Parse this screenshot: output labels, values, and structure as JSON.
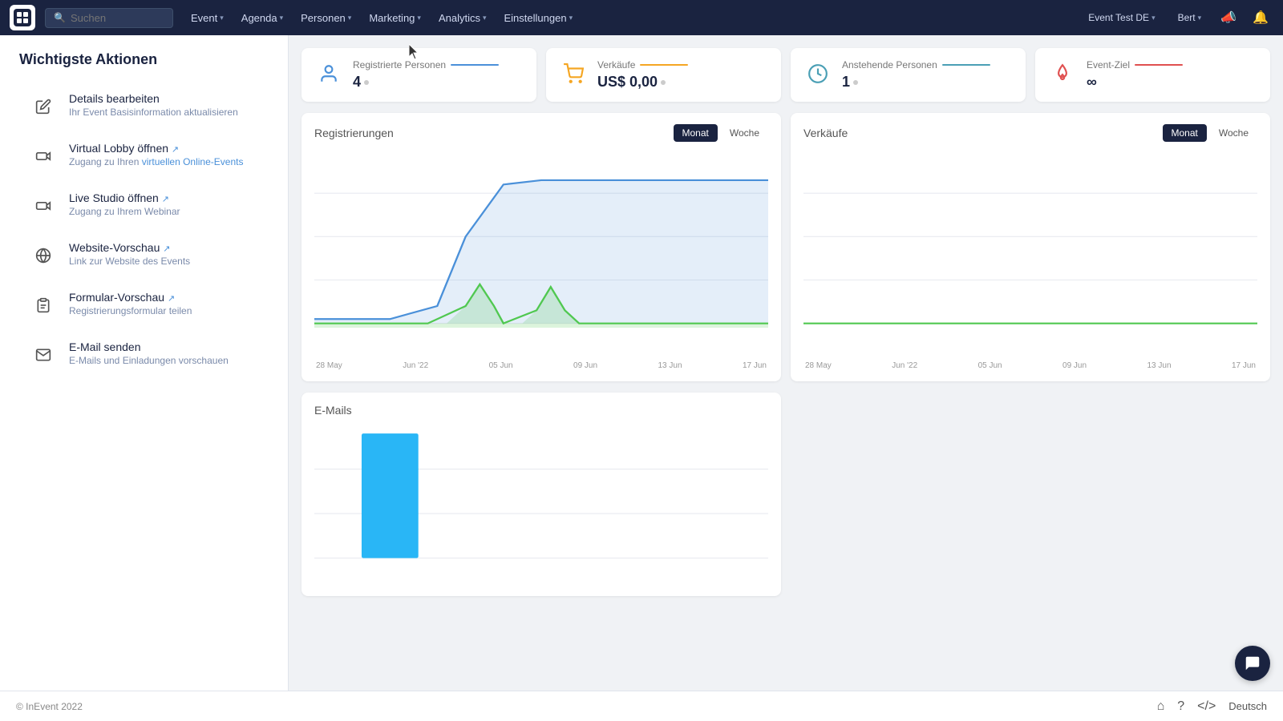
{
  "navbar": {
    "search_placeholder": "Suchen",
    "nav_items": [
      {
        "label": "Event",
        "id": "event"
      },
      {
        "label": "Agenda",
        "id": "agenda"
      },
      {
        "label": "Personen",
        "id": "personen"
      },
      {
        "label": "Marketing",
        "id": "marketing"
      },
      {
        "label": "Analytics",
        "id": "analytics"
      },
      {
        "label": "Einstellungen",
        "id": "einstellungen"
      }
    ],
    "right_items": [
      {
        "label": "Event Test DE",
        "id": "event-test"
      },
      {
        "label": "Bert",
        "id": "user"
      }
    ]
  },
  "sidebar": {
    "title": "Wichtigste Aktionen",
    "items": [
      {
        "id": "details-bearbeiten",
        "label": "Details bearbeiten",
        "desc": "Ihr Event Basisinformation aktualisieren",
        "icon": "pencil"
      },
      {
        "id": "virtual-lobby",
        "label": "Virtual Lobby öffnen",
        "desc": "Zugang zu Ihren virtuellen Online-Events",
        "icon": "video",
        "external": true
      },
      {
        "id": "live-studio",
        "label": "Live Studio öffnen",
        "desc": "Zugang zu Ihrem Webinar",
        "icon": "video",
        "external": true
      },
      {
        "id": "website-vorschau",
        "label": "Website-Vorschau",
        "desc": "Link zur Website des Events",
        "icon": "globe",
        "external": true
      },
      {
        "id": "formular-vorschau",
        "label": "Formular-Vorschau",
        "desc": "Registrierungsformular teilen",
        "icon": "clipboard",
        "external": true
      },
      {
        "id": "email-senden",
        "label": "E-Mail senden",
        "desc": "E-Mails und Einladungen vorschauen",
        "icon": "envelope"
      }
    ]
  },
  "stats": [
    {
      "id": "registrierte-personen",
      "label": "Registrierte Personen",
      "value": "4",
      "dot": true,
      "color": "blue",
      "icon": "person"
    },
    {
      "id": "verkaufe",
      "label": "Verkäufe",
      "value": "US$ 0,00",
      "dot": true,
      "color": "orange",
      "icon": "cart"
    },
    {
      "id": "anstehende-personen",
      "label": "Anstehende Personen",
      "value": "1",
      "dot": true,
      "color": "teal",
      "icon": "clock"
    },
    {
      "id": "event-ziel",
      "label": "Event-Ziel",
      "value": "∞",
      "dot": false,
      "color": "red",
      "icon": "fire"
    }
  ],
  "charts": {
    "registrierungen": {
      "title": "Registrierungen",
      "tabs": [
        "Monat",
        "Woche"
      ],
      "active_tab": "Monat",
      "x_labels": [
        "28 May",
        "Jun '22",
        "05 Jun",
        "09 Jun",
        "13 Jun",
        "17 Jun"
      ]
    },
    "verkaufe": {
      "title": "Verkäufe",
      "tabs": [
        "Monat",
        "Woche"
      ],
      "active_tab": "Monat",
      "x_labels": [
        "28 May",
        "Jun '22",
        "05 Jun",
        "09 Jun",
        "13 Jun",
        "17 Jun"
      ]
    },
    "emails": {
      "title": "E-Mails"
    }
  },
  "footer": {
    "copyright": "© InEvent 2022",
    "language": "Deutsch"
  }
}
